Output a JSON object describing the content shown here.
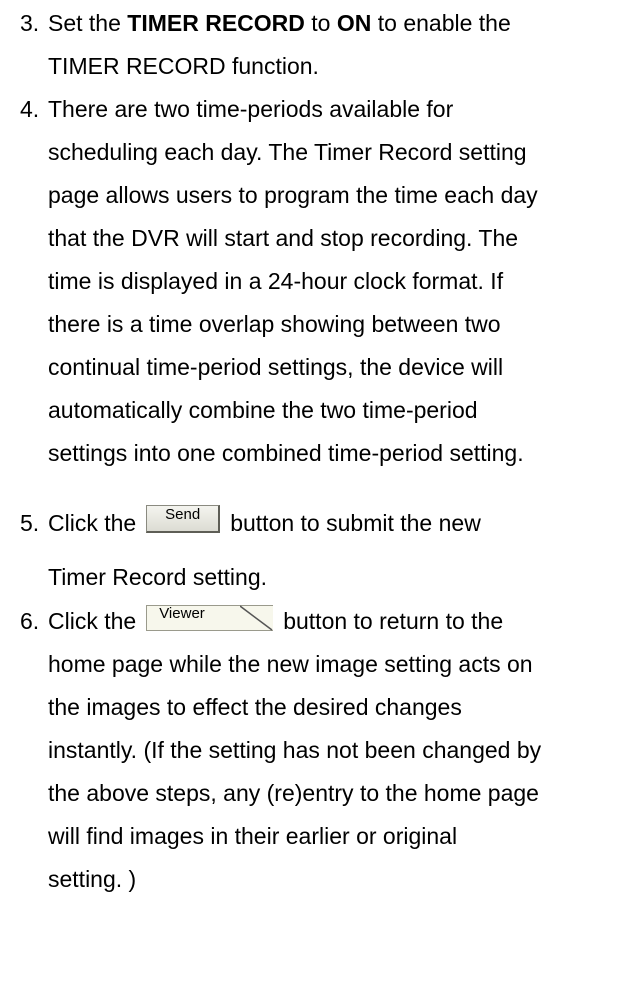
{
  "steps": [
    {
      "num": "3.",
      "l1a": "Set the ",
      "l1b": "TIMER RECORD",
      "l1c": " to ",
      "l1d": "ON",
      "l1e": " to enable the",
      "l2": "TIMER RECORD function."
    },
    {
      "num": "4.",
      "lines": [
        "There are two time-periods available for",
        "scheduling each day. The Timer Record setting",
        "page allows users to program the time each day",
        "that the DVR will start and stop recording. The",
        "time is displayed in a 24-hour clock format. If",
        "there is a time overlap showing between two",
        "continual time-period settings, the device will",
        "automatically combine the two time-period",
        "settings into one combined time-period setting."
      ]
    },
    {
      "num": "5.",
      "pre": "Click the",
      "button": "Send",
      "post": "button to submit the new",
      "l2": "Timer Record setting."
    },
    {
      "num": "6.",
      "pre": "Click the",
      "button": "Viewer",
      "post": "button to return to the",
      "lines": [
        "home page while the new image setting acts on",
        "the images to effect the desired changes",
        "instantly. (If the setting has not been changed by",
        "the above steps, any (re)entry to the home page",
        "will find images in their earlier or original",
        "setting. )"
      ]
    }
  ]
}
